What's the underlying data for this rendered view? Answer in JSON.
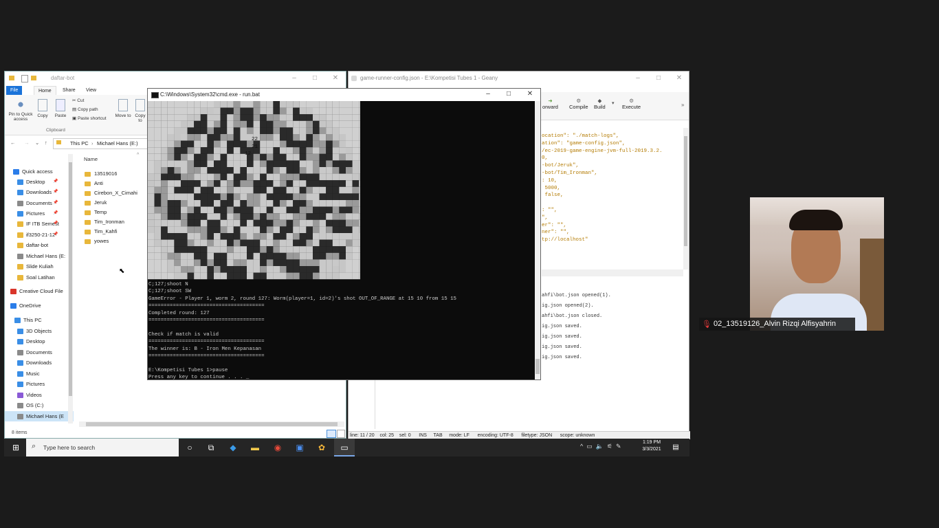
{
  "explorer": {
    "title": "daftar-bot",
    "tabs": [
      "File",
      "Home",
      "Share",
      "View"
    ],
    "ribbon": {
      "pin_label": "Pin to Quick access",
      "copy_label": "Copy",
      "paste_label": "Paste",
      "cut_label": "Cut",
      "copy_path_label": "Copy path",
      "paste_shortcut_label": "Paste shortcut",
      "clipboard_group": "Clipboard",
      "move_to_label": "Move to",
      "copy_to_label": "Copy to"
    },
    "breadcrumb": [
      "This PC",
      "Michael Hans (E:)"
    ],
    "column_name": "Name",
    "nav_items": [
      {
        "label": "Quick access",
        "color": "#2b7de9"
      },
      {
        "label": "Desktop",
        "color": "#3a8ee6"
      },
      {
        "label": "Downloads",
        "color": "#3a8ee6"
      },
      {
        "label": "Documents",
        "color": "#8a8a8a"
      },
      {
        "label": "Pictures",
        "color": "#3a8ee6"
      },
      {
        "label": "IF ITB Semest",
        "color": "#e8b73b"
      },
      {
        "label": "if3250-21-12-",
        "color": "#e8b73b"
      },
      {
        "label": "daftar-bot",
        "color": "#e8b73b"
      },
      {
        "label": "Michael Hans (E:",
        "color": "#8a8a8a"
      },
      {
        "label": "Slide Kuliah",
        "color": "#e8b73b"
      },
      {
        "label": "Soal Latihan",
        "color": "#e8b73b"
      },
      {
        "label": "Creative Cloud File",
        "color": "#d9352a"
      },
      {
        "label": "OneDrive",
        "color": "#2b7de9"
      },
      {
        "label": "This PC",
        "color": "#3a8ee6"
      },
      {
        "label": "3D Objects",
        "color": "#3a8ee6"
      },
      {
        "label": "Desktop",
        "color": "#3a8ee6"
      },
      {
        "label": "Documents",
        "color": "#8a8a8a"
      },
      {
        "label": "Downloads",
        "color": "#3a8ee6"
      },
      {
        "label": "Music",
        "color": "#3a8ee6"
      },
      {
        "label": "Pictures",
        "color": "#3a8ee6"
      },
      {
        "label": "Videos",
        "color": "#8a5ad6"
      },
      {
        "label": "OS (C:)",
        "color": "#8a8a8a"
      },
      {
        "label": "Michael Hans (E",
        "color": "#8a8a8a"
      },
      {
        "label": "Network",
        "color": "#3a8ee6"
      }
    ],
    "files": [
      "13519016",
      "Anti",
      "Cirebon_X_Cimahi",
      "Jeruk",
      "Temp",
      "Tim_Ironman",
      "Tim_Kahfi",
      "yowes"
    ],
    "status": "8 items"
  },
  "geany": {
    "title": "game-runner-config.json - E:\\Kompetisi Tubes 1 - Geany",
    "toolbar": {
      "forward": "orward",
      "compile": "Compile",
      "build": "Build",
      "execute": "Execute"
    },
    "code_lines": [
      "ocation\": \"./match-logs\",",
      "ation\": \"game-config.json\",",
      "/ec-2019-game-engine-jvm-full-2019.3.2.",
      "0,",
      "-bot/Jeruk\",",
      "-bot/Tim_Ironman\",",
      ": 10,",
      " 5000,",
      " false,",
      "",
      ": \"\",",
      "\",",
      "er\": \"\",",
      "ner\": \"\",",
      "tp://localhost\""
    ],
    "messages": [
      "ahfi\\bot.json opened(1).",
      "ig.json opened(2).",
      "ahfi\\bot.json closed.",
      "ig.json saved.",
      "ig.json saved.",
      "ig.json saved.",
      "ig.json saved."
    ],
    "statusbar": "line: 11 / 20    col: 25    sel: 0      INS     TAB     mode: LF      encoding: UTF-8      filetype: JSON      scope: unknown"
  },
  "cmd": {
    "title": "C:\\Windows\\System32\\cmd.exe - run.bat",
    "map_numbers": [
      "22",
      "21",
      "12"
    ],
    "lines": [
      "C;127;shoot N",
      "C;127;shoot SW",
      "GameError - Player 1, worm 2, round 127: Worm(player=1, id=2)'s shot OUT_OF_RANGE at 15 10 from 15 15",
      "======================================",
      "Completed round: 127",
      "======================================",
      "",
      "Check if match is valid",
      "======================================",
      "The winner is: B - Iron Men Kepanasan",
      "======================================",
      "",
      "E:\\Kompetisi Tubes 1>pause",
      "Press any key to continue . . . _"
    ]
  },
  "taskbar": {
    "search_placeholder": "Type here to search",
    "time": "1:19 PM",
    "date": "3/3/2021"
  },
  "video": {
    "participant_name": "02_13519126_Alvin Rizqi Alfisyahrin"
  }
}
